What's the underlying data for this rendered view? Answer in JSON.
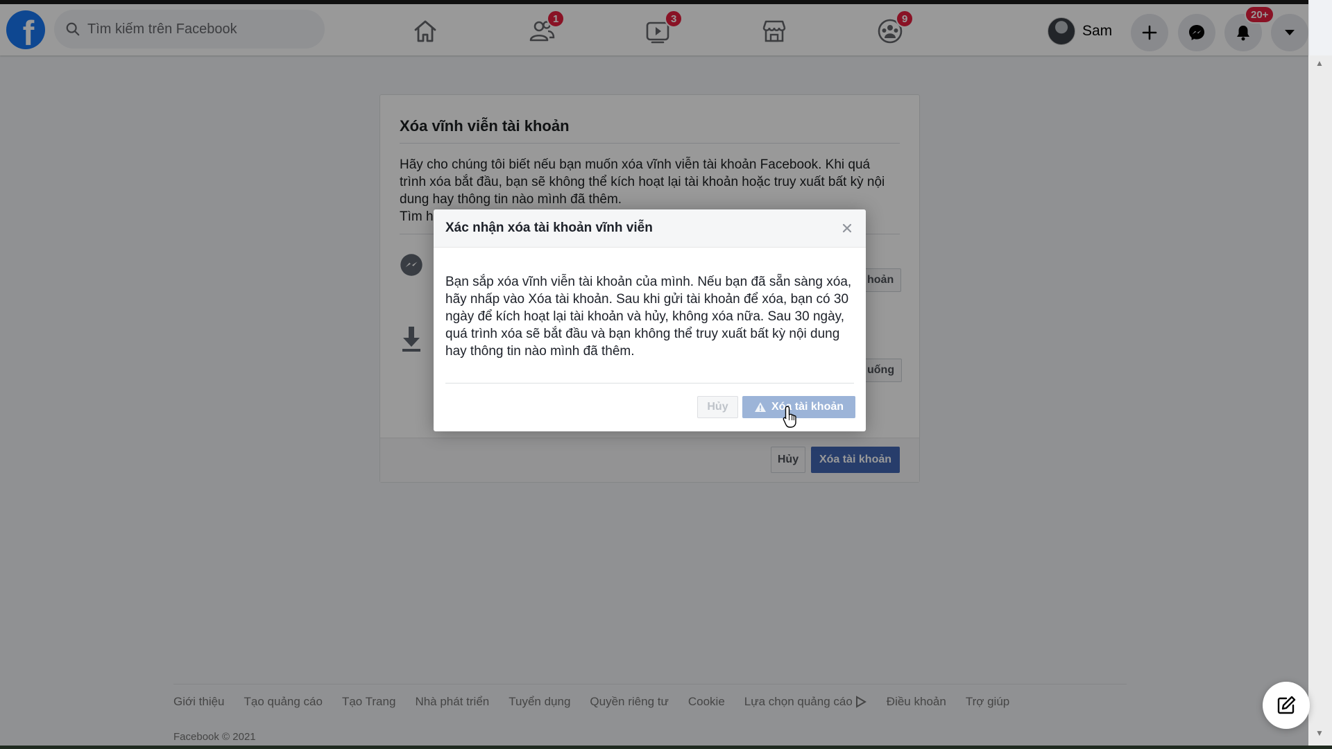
{
  "search": {
    "placeholder": "Tìm kiếm trên Facebook"
  },
  "nav": {
    "friends_badge": "1",
    "watch_badge": "3",
    "groups_badge": "9"
  },
  "profile": {
    "name": "Sam"
  },
  "notifications_badge": "20+",
  "page": {
    "title": "Xóa vĩnh viễn tài khoản",
    "description_1": "Hãy cho chúng tôi biết nếu bạn muốn xóa vĩnh viễn tài khoản Facebook. Khi quá trình xóa bắt đầu, bạn sẽ không thể kích hoạt lại tài khoản hoặc truy xuất bất kỳ nội dung hay thông tin nào mình đã thêm.",
    "learn_more_fragment": "Tìm h",
    "messenger_option_button_fragment": "hoản",
    "download_option_button_fragment": "uống",
    "cancel_label": "Hủy",
    "delete_label": "Xóa tài khoản"
  },
  "dialog": {
    "title": "Xác nhận xóa tài khoản vĩnh viễn",
    "body": "Bạn sắp xóa vĩnh viễn tài khoản của mình. Nếu bạn đã sẵn sàng xóa, hãy nhấp vào Xóa tài khoản. Sau khi gửi tài khoản để xóa, bạn có 30 ngày để kích hoạt lại tài khoản và hủy, không xóa nữa. Sau 30 ngày, quá trình xóa sẽ bắt đầu và bạn không thể truy xuất bất kỳ nội dung hay thông tin nào mình đã thêm.",
    "cancel_label": "Hủy",
    "confirm_label": "Xóa tài khoản"
  },
  "footer": {
    "links": [
      "Giới thiệu",
      "Tạo quảng cáo",
      "Tạo Trang",
      "Nhà phát triển",
      "Tuyển dụng",
      "Quyền riêng tư",
      "Cookie",
      "Lựa chọn quảng cáo",
      "Điều khoản",
      "Trợ giúp"
    ],
    "copyright": "Facebook © 2021"
  },
  "colors": {
    "brand": "#1877f2",
    "primary_button": "#4267b2",
    "primary_button_disabled": "#9cb4d8",
    "badge": "#e41e3f"
  },
  "icons": {
    "logo": "facebook-logo",
    "search": "search-icon",
    "home": "home-icon",
    "friends": "friends-icon",
    "watch": "watch-icon",
    "marketplace": "marketplace-icon",
    "groups": "groups-icon",
    "create": "plus-icon",
    "messenger": "messenger-icon",
    "notifications": "bell-icon",
    "account": "caret-down-icon",
    "close": "close-icon",
    "warning": "warning-icon",
    "edit": "new-message-icon",
    "download": "download-icon",
    "ad_choices": "ad-choices-icon"
  }
}
